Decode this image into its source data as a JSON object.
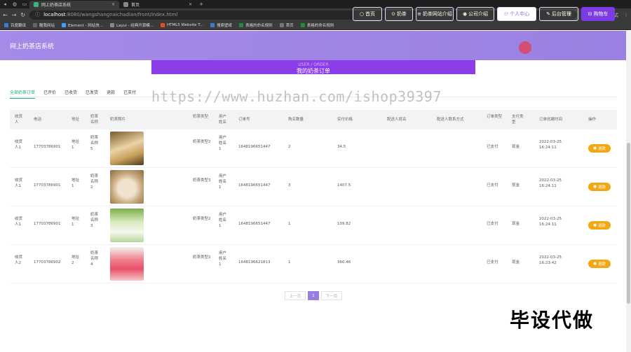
{
  "browser": {
    "tabs": [
      {
        "label": "网上奶茶店系统",
        "active": true
      },
      {
        "label": "首页",
        "active": false
      }
    ],
    "new_tab": "+",
    "url_host": "localhost",
    "url_rest": ":8080/wangshangnaichadian/front/index.html",
    "profile_label": "无痕模式",
    "bookmarks": [
      "百度翻译",
      "酷我网站",
      "Element - 网站快...",
      "Layui - 经典开源模...",
      "HTML5 Website T...",
      "搜索壁纸",
      "表格的命名规则",
      "首页",
      "表格的命名规则"
    ]
  },
  "header": {
    "brand": "网上奶茶店系统",
    "nav": [
      {
        "label": "首页",
        "icon": "○"
      },
      {
        "label": "奶茶",
        "icon": "⊙"
      },
      {
        "label": "奶茶网站介绍",
        "icon": "≡"
      },
      {
        "label": "公司介绍",
        "icon": "◉"
      },
      {
        "label": "个人中心",
        "icon": "⚇"
      },
      {
        "label": "后台管理",
        "icon": "✎"
      },
      {
        "label": "购物车",
        "icon": "⊟"
      }
    ]
  },
  "banner": {
    "en": "USER / ORDER",
    "cn": "我的奶茶订单"
  },
  "order_tabs": [
    "全部奶茶订单",
    "已评价",
    "已收货",
    "已发货",
    "退款",
    "已支付"
  ],
  "watermark": "https://www.huzhan.com/ishop39397",
  "table": {
    "headers": [
      "收货人",
      "电话",
      "地址",
      "奶茶名称",
      "奶茶照片",
      "奶茶类型",
      "用户姓名",
      "订单号",
      "购买数量",
      "实付价格",
      "配送人姓名",
      "配送人联系方式",
      "订单类型",
      "支付类型",
      "订单创建时间",
      "操作"
    ],
    "rows": [
      {
        "receiver": "收货人1",
        "phone": "17703786901",
        "address": "地址1",
        "tea": "奶茶名称5",
        "type": "奶茶类型2",
        "user": "用户姓名1",
        "order_no": "1648196651447",
        "qty": "2",
        "price": "34.5",
        "status": "已支付",
        "pay": "现金",
        "date": "2022-03-25",
        "time": "16:24:11",
        "action": "退款",
        "img": "a"
      },
      {
        "receiver": "收货人1",
        "phone": "17703786901",
        "address": "地址1",
        "tea": "奶茶名称2",
        "type": "奶茶类型3",
        "user": "用户姓名1",
        "order_no": "1648196651447",
        "qty": "3",
        "price": "1407.5",
        "status": "已支付",
        "pay": "现金",
        "date": "2022-03-25",
        "time": "16:24:11",
        "action": "退款",
        "img": "b"
      },
      {
        "receiver": "收货人1",
        "phone": "17703786901",
        "address": "地址1",
        "tea": "奶茶名称3",
        "type": "奶茶类型2",
        "user": "用户姓名1",
        "order_no": "1648196651447",
        "qty": "1",
        "price": "109.82",
        "status": "已支付",
        "pay": "现金",
        "date": "2022-03-25",
        "time": "16:24:11",
        "action": "退款",
        "img": "c"
      },
      {
        "receiver": "收货人2",
        "phone": "17703786902",
        "address": "地址2",
        "tea": "奶茶名称4",
        "type": "奶茶类型2",
        "user": "用户姓名1",
        "order_no": "1648196621813",
        "qty": "1",
        "price": "360.46",
        "status": "已支付",
        "pay": "现金",
        "date": "2022-03-25",
        "time": "16:23:42",
        "action": "退款",
        "img": "d"
      }
    ]
  },
  "pager": {
    "prev": "上一页",
    "current": "1",
    "next": "下一页"
  },
  "corner_text": "毕设代做",
  "colors": {
    "header": "#a58ae8",
    "banner": "#8b3ee8",
    "active_tab": "#19a974",
    "pay_button": "#f3a712"
  }
}
